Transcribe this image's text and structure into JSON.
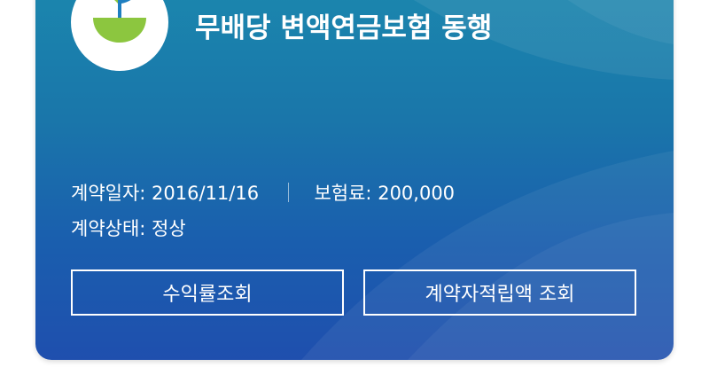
{
  "product": {
    "logo_icon": "sprout-bowl-icon",
    "title": "무배당 변액연금보험 동행"
  },
  "contract": {
    "date_label": "계약일자:",
    "date_value": "2016/11/16",
    "premium_label": "보험료:",
    "premium_value": "200,000",
    "status_label": "계약상태:",
    "status_value": "정상"
  },
  "actions": {
    "yield_button": "수익률조회",
    "reserve_button": "계약자적립액 조회"
  },
  "colors": {
    "card_top": "#1b88ae",
    "card_bottom": "#1f4fae",
    "logo_green": "#8cc63f",
    "logo_blue": "#1f7fc0"
  }
}
